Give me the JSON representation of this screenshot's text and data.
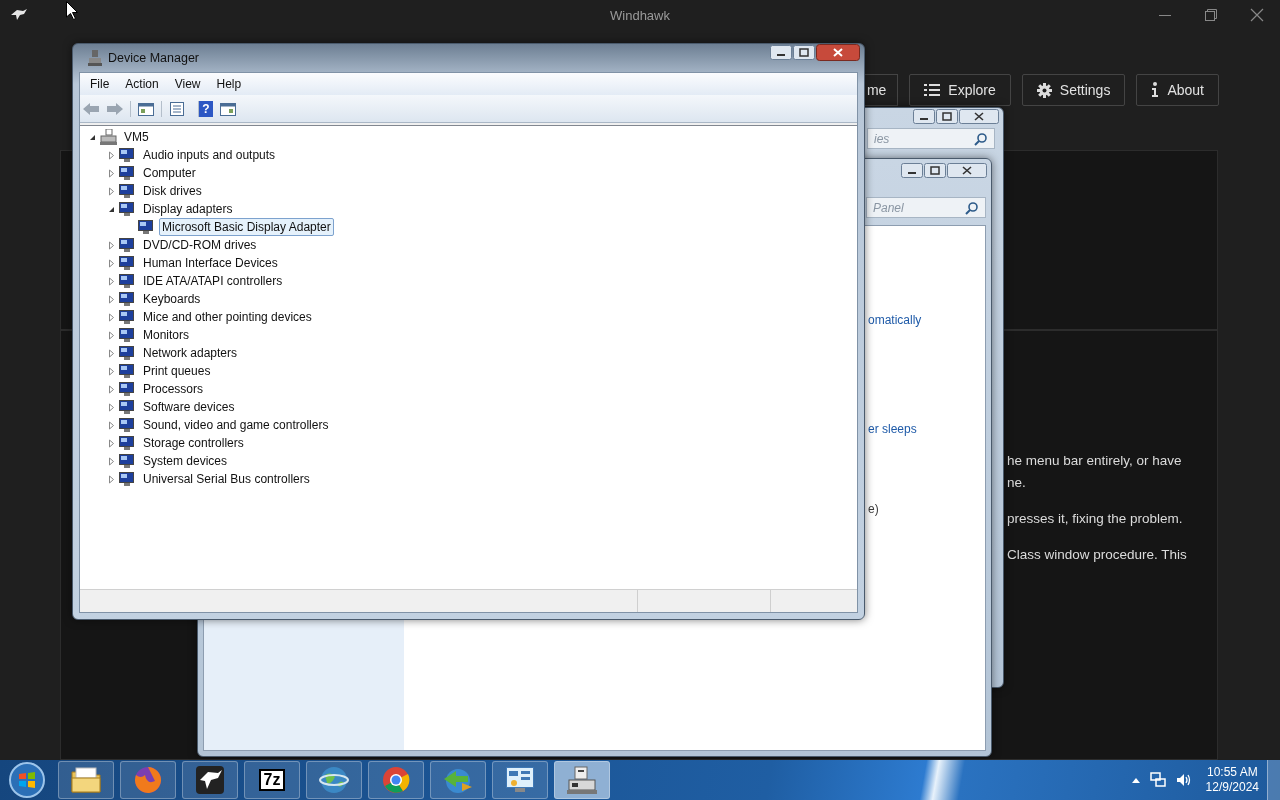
{
  "windhawk": {
    "title": "Windhawk",
    "nav": [
      {
        "label": "me"
      },
      {
        "label": "Explore",
        "kind": "list"
      },
      {
        "label": "Settings",
        "kind": "gear"
      },
      {
        "label": "About",
        "kind": "info"
      }
    ],
    "text_fragments": [
      "he menu bar entirely, or have",
      "ne.",
      "presses it, fixing the problem.",
      "Class window procedure. This"
    ]
  },
  "control_panel_back": {
    "search_placeholder": "ies"
  },
  "control_panel_front": {
    "search_placeholder": "Panel",
    "links": [
      "omatically",
      "er sleeps"
    ],
    "note": "e)"
  },
  "device_manager": {
    "title": "Device Manager",
    "menu": [
      "File",
      "Action",
      "View",
      "Help"
    ],
    "toolbar": [
      {
        "kind": "back",
        "disabled": true
      },
      {
        "kind": "forward",
        "disabled": true
      },
      {
        "kind": "console",
        "disabled": false
      },
      {
        "kind": "properties",
        "disabled": false
      },
      {
        "kind": "help",
        "label": "?",
        "disabled": false
      },
      {
        "kind": "view",
        "disabled": false
      }
    ],
    "tree": {
      "label": "VM5",
      "expanded": true,
      "selected": false,
      "children": [
        {
          "label": "Audio inputs and outputs",
          "expanded": false,
          "selected": false
        },
        {
          "label": "Computer",
          "expanded": false,
          "selected": false
        },
        {
          "label": "Disk drives",
          "expanded": false,
          "selected": false
        },
        {
          "label": "Display adapters",
          "expanded": true,
          "selected": false,
          "children": [
            {
              "label": "Microsoft Basic Display Adapter",
              "selected": true
            }
          ]
        },
        {
          "label": "DVD/CD-ROM drives",
          "expanded": false,
          "selected": false
        },
        {
          "label": "Human Interface Devices",
          "expanded": false,
          "selected": false
        },
        {
          "label": "IDE ATA/ATAPI controllers",
          "expanded": false,
          "selected": false
        },
        {
          "label": "Keyboards",
          "expanded": false,
          "selected": false
        },
        {
          "label": "Mice and other pointing devices",
          "expanded": false,
          "selected": false
        },
        {
          "label": "Monitors",
          "expanded": false,
          "selected": false
        },
        {
          "label": "Network adapters",
          "expanded": false,
          "selected": false
        },
        {
          "label": "Print queues",
          "expanded": false,
          "selected": false
        },
        {
          "label": "Processors",
          "expanded": false,
          "selected": false
        },
        {
          "label": "Software devices",
          "expanded": false,
          "selected": false
        },
        {
          "label": "Sound, video and game controllers",
          "expanded": false,
          "selected": false
        },
        {
          "label": "Storage controllers",
          "expanded": false,
          "selected": false
        },
        {
          "label": "System devices",
          "expanded": false,
          "selected": false
        },
        {
          "label": "Universal Serial Bus controllers",
          "expanded": false,
          "selected": false
        }
      ]
    }
  },
  "taskbar": {
    "apps": [
      {
        "kind": "folder",
        "selected": false
      },
      {
        "kind": "firefox",
        "selected": false
      },
      {
        "kind": "bird",
        "selected": false
      },
      {
        "kind": "archive",
        "label": "7z",
        "selected": false
      },
      {
        "kind": "globe",
        "selected": false
      },
      {
        "kind": "chrome",
        "selected": false
      },
      {
        "kind": "download",
        "selected": false
      },
      {
        "kind": "control_panel",
        "selected": false
      },
      {
        "kind": "computer",
        "selected": true
      }
    ],
    "clock": {
      "time": "10:55 AM",
      "date": "12/9/2024"
    }
  }
}
